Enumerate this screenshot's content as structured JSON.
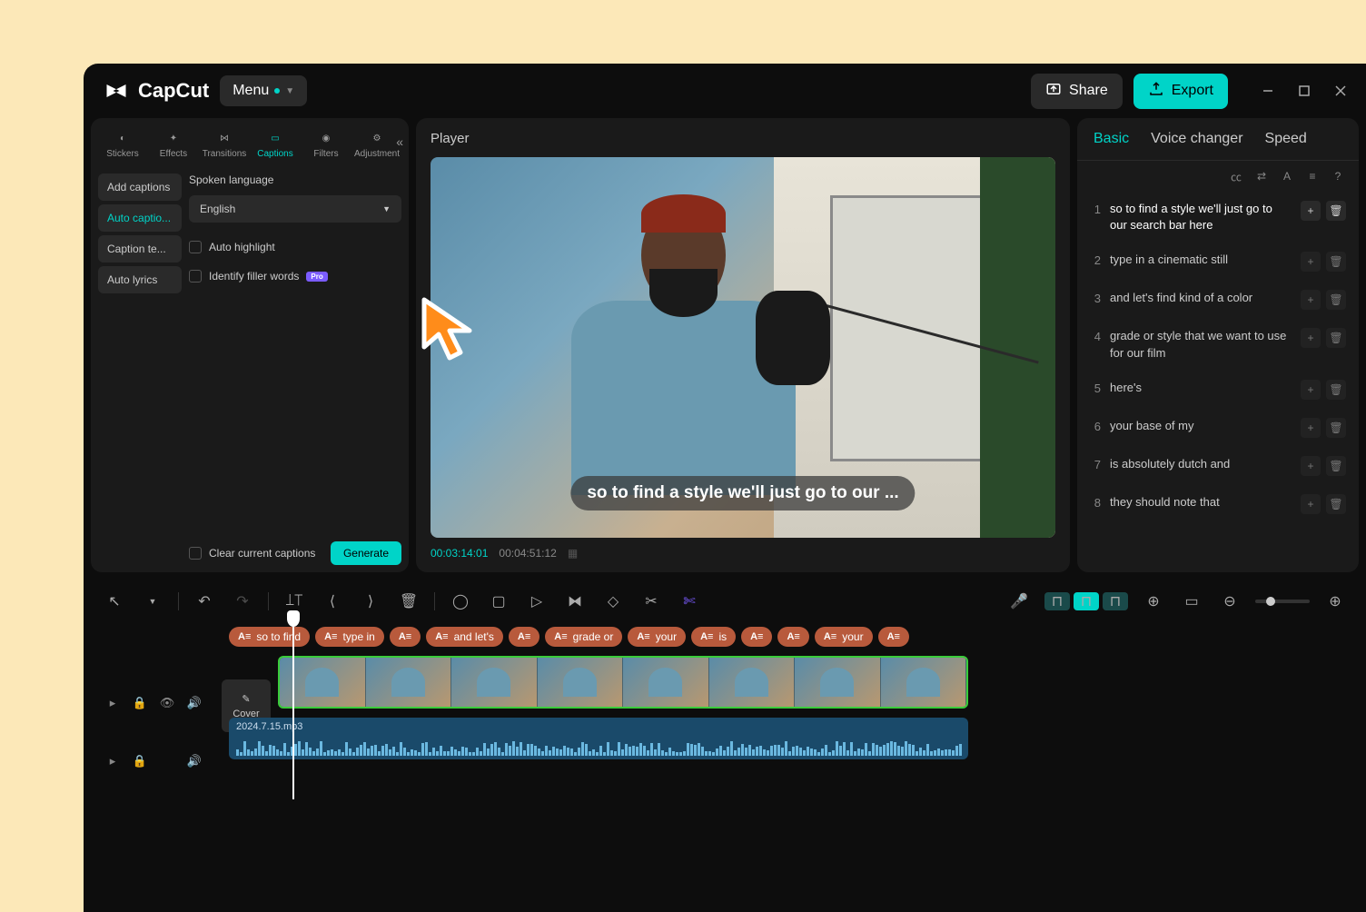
{
  "titlebar": {
    "app_name": "CapCut",
    "menu_label": "Menu",
    "share_label": "Share",
    "export_label": "Export"
  },
  "tool_tabs": [
    {
      "label": "Stickers",
      "icon": "◐"
    },
    {
      "label": "Effects",
      "icon": "✦"
    },
    {
      "label": "Transitions",
      "icon": "⋈"
    },
    {
      "label": "Captions",
      "icon": "▭",
      "active": true
    },
    {
      "label": "Filters",
      "icon": "◉"
    },
    {
      "label": "Adjustment",
      "icon": "⚙"
    }
  ],
  "caption_types": [
    {
      "label": "Add captions"
    },
    {
      "label": "Auto captio...",
      "active": true
    },
    {
      "label": "Caption te..."
    },
    {
      "label": "Auto lyrics"
    }
  ],
  "caption_settings": {
    "spoken_language_label": "Spoken language",
    "language_value": "English",
    "auto_highlight_label": "Auto highlight",
    "identify_filler_label": "Identify filler words",
    "pro_badge": "Pro",
    "clear_label": "Clear current captions",
    "generate_label": "Generate"
  },
  "player": {
    "title": "Player",
    "caption_overlay": "so to find a style we'll just go to our ...",
    "time_current": "00:03:14:01",
    "time_total": "00:04:51:12"
  },
  "right_tabs": [
    {
      "label": "Basic",
      "active": true
    },
    {
      "label": "Voice changer"
    },
    {
      "label": "Speed"
    }
  ],
  "segments": [
    {
      "num": "1",
      "text": "so to find a style we'll just go to our search bar here",
      "active": true
    },
    {
      "num": "2",
      "text": "type in a cinematic still"
    },
    {
      "num": "3",
      "text": "and let's find kind of a color"
    },
    {
      "num": "4",
      "text": "grade or style that we want to use for our film"
    },
    {
      "num": "5",
      "text": "here's"
    },
    {
      "num": "6",
      "text": "your base of my"
    },
    {
      "num": "7",
      "text": "is absolutely dutch and"
    },
    {
      "num": "8",
      "text": "they should note that"
    }
  ],
  "caption_pills": [
    {
      "label": "so to find"
    },
    {
      "label": "type in"
    },
    {
      "label": ""
    },
    {
      "label": "and let's"
    },
    {
      "label": ""
    },
    {
      "label": "grade or"
    },
    {
      "label": "your"
    },
    {
      "label": "is"
    },
    {
      "label": ""
    },
    {
      "label": ""
    },
    {
      "label": "your"
    },
    {
      "label": ""
    }
  ],
  "timeline": {
    "cover_label": "Cover",
    "audio_file": "2024.7.15.mp3"
  }
}
